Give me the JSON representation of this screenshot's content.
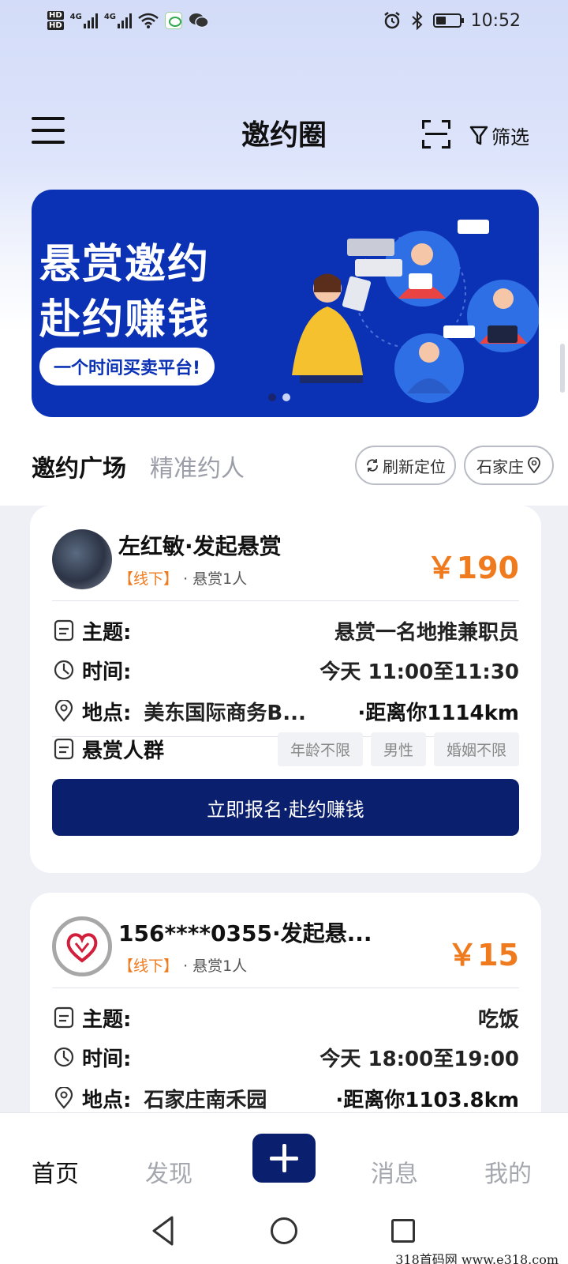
{
  "status_bar": {
    "hd1": "HD",
    "hd2": "HD",
    "net1": "4G",
    "net2": "4G",
    "time": "10:52"
  },
  "header": {
    "title": "邀约圈",
    "filter_label": "筛选"
  },
  "banner": {
    "line1": "悬赏邀约",
    "line2": "赴约赚钱",
    "pill": "一个时间买卖平台!"
  },
  "tabs": {
    "active": "邀约广场",
    "inactive": "精准约人",
    "refresh_label": "刷新定位",
    "city_label": "石家庄"
  },
  "cards": [
    {
      "name": "左红敏·发起悬赏",
      "mode": "【线下】",
      "meta": "· 悬赏1人",
      "price": "￥190",
      "topic_label": "主题:",
      "topic": "悬赏一名地推兼职员",
      "time_label": "时间:",
      "time": "今天 11:00至11:30",
      "place_label": "地点:",
      "place": "美东国际商务B...",
      "distance": "·距离你1114km",
      "crowd_label": "悬赏人群",
      "tags": [
        "年龄不限",
        "男性",
        "婚姻不限"
      ],
      "button": "立即报名·赴约赚钱"
    },
    {
      "name": "156****0355·发起悬...",
      "mode": "【线下】",
      "meta": "· 悬赏1人",
      "price": "￥15",
      "topic_label": "主题:",
      "topic": "吃饭",
      "time_label": "时间:",
      "time": "今天 18:00至19:00",
      "place_label": "地点:",
      "place": "石家庄南禾园",
      "distance": "·距离你1103.8km"
    }
  ],
  "bottom_nav": {
    "home": "首页",
    "discover": "发现",
    "messages": "消息",
    "mine": "我的"
  },
  "watermark": "318首码网  www.e318.com",
  "colors": {
    "brand_navy": "#0a1f6e",
    "banner_blue": "#0b32b5",
    "price_orange": "#f07b1e"
  }
}
